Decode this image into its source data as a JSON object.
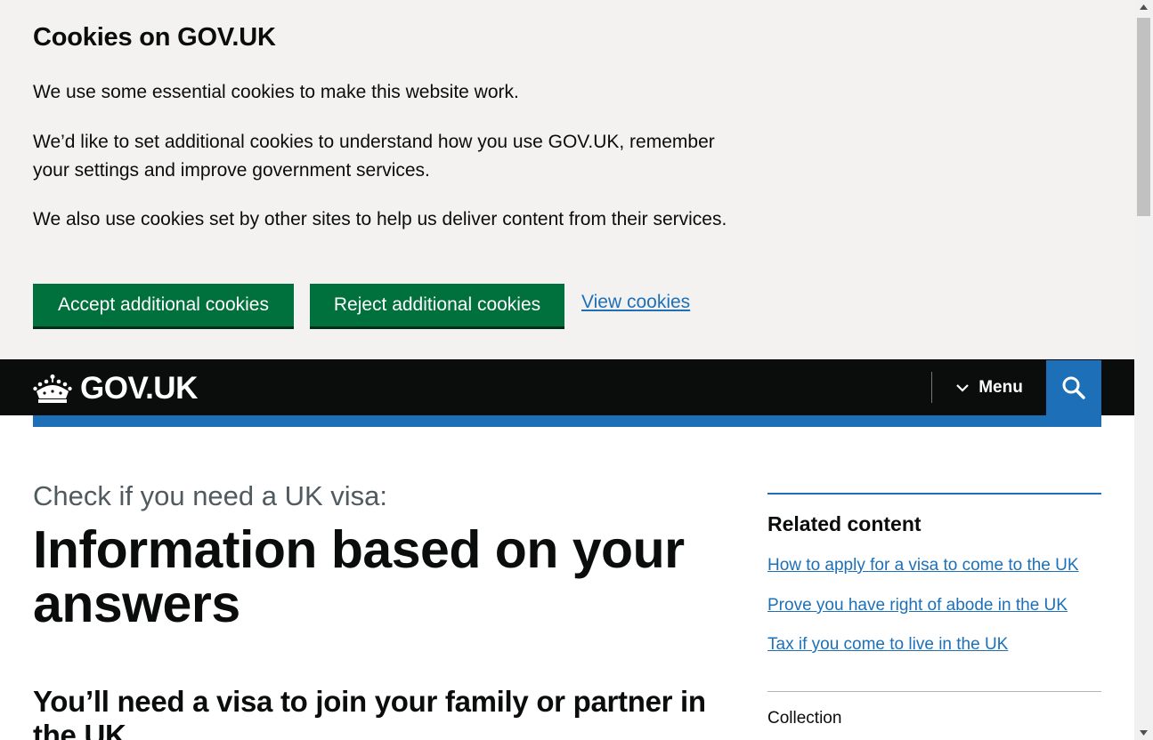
{
  "cookie_banner": {
    "heading": "Cookies on GOV.UK",
    "paragraph_1": "We use some essential cookies to make this website work.",
    "paragraph_2": "We’d like to set additional cookies to understand how you use GOV.UK, remember your settings and improve government services.",
    "paragraph_3": "We also use cookies set by other sites to help us deliver content from their services.",
    "accept_label": "Accept additional cookies",
    "reject_label": "Reject additional cookies",
    "view_label": "View cookies"
  },
  "header": {
    "logo_text": "GOV.UK",
    "logo_icon": "crown-icon",
    "menu_label": "Menu",
    "menu_icon": "chevron-down-icon",
    "search_icon": "search-icon"
  },
  "main": {
    "caption": "Check if you need a UK visa:",
    "title": "Information based on your answers",
    "section_heading": "You’ll need a visa to join your family or partner in the UK"
  },
  "sidebar": {
    "related_heading": "Related content",
    "links": [
      "How to apply for a visa to come to the UK",
      "Prove you have right of abode in the UK",
      "Tax if you come to live in the UK"
    ],
    "collection_label": "Collection"
  },
  "colors": {
    "button_green": "#00703c",
    "link_blue": "#1d70b8",
    "header_black": "#0b0c0c",
    "banner_grey": "#f3f2f1"
  }
}
